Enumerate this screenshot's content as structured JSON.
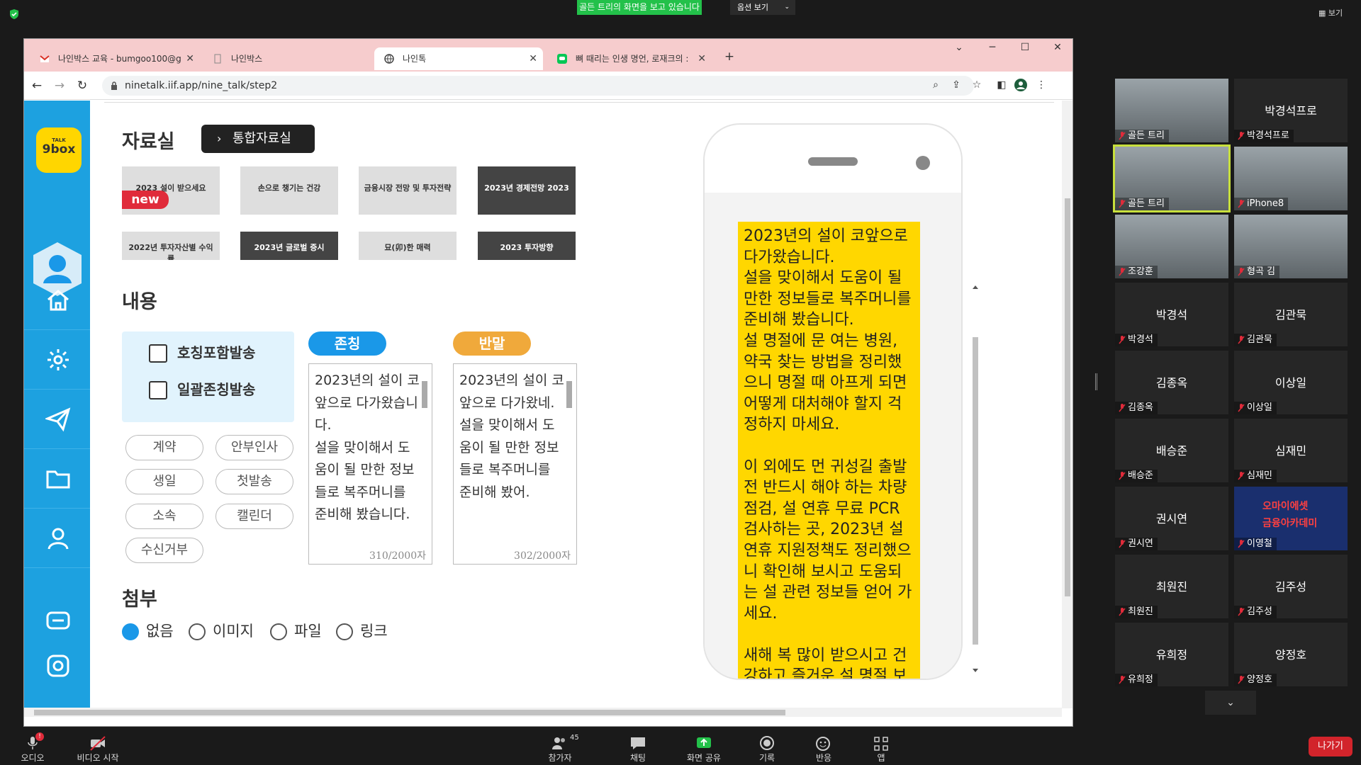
{
  "zoom": {
    "share_banner": "골든 트리의 화면을 보고 있습니다",
    "options_label": "옵션 보기",
    "view_label": "보기",
    "leave_label": "나가기",
    "toolbar": [
      {
        "label": "오디오",
        "icon": "mic-muted-icon"
      },
      {
        "label": "비디오 시작",
        "icon": "video-off-icon"
      },
      {
        "label": "참가자",
        "icon": "participants-icon",
        "count": "45"
      },
      {
        "label": "채팅",
        "icon": "chat-icon"
      },
      {
        "label": "화면 공유",
        "icon": "share-screen-icon"
      },
      {
        "label": "기록",
        "icon": "record-icon"
      },
      {
        "label": "반응",
        "icon": "reaction-icon"
      },
      {
        "label": "앱",
        "icon": "apps-icon"
      }
    ],
    "mic_badge": "!",
    "participants": [
      {
        "name": "골든 트리",
        "label": "골든 트리",
        "video": true
      },
      {
        "name": "박경석프로",
        "label": "박경석프로",
        "video": false
      },
      {
        "name": "골든 트리",
        "label": "골든 트리",
        "video": true,
        "speaker": true
      },
      {
        "name": "iPhone8",
        "label": "iPhone8",
        "video": true
      },
      {
        "name": "조강훈",
        "label": "조강훈",
        "video": true
      },
      {
        "name": "형곡 김",
        "label": "형곡 김",
        "video": true
      },
      {
        "name": "박경석",
        "label": "박경석",
        "video": false
      },
      {
        "name": "김관묵",
        "label": "김관묵",
        "video": false
      },
      {
        "name": "김종옥",
        "label": "김종옥",
        "video": false
      },
      {
        "name": "이상일",
        "label": "이상일",
        "video": false
      },
      {
        "name": "배승준",
        "label": "배승준",
        "video": false
      },
      {
        "name": "심재민",
        "label": "심재민",
        "video": false
      },
      {
        "name": "권시연",
        "label": "권시연",
        "video": false
      },
      {
        "name": "이영철",
        "label": "이영철",
        "video": true,
        "overlay": "오마이에셋\n금융아카데미"
      },
      {
        "name": "최원진",
        "label": "최원진",
        "video": false
      },
      {
        "name": "김주성",
        "label": "김주성",
        "video": false
      },
      {
        "name": "유희정",
        "label": "유희정",
        "video": false
      },
      {
        "name": "양정호",
        "label": "양정호",
        "video": false
      }
    ]
  },
  "browser": {
    "tabs": [
      {
        "title": "나인박스 교육 - bumgoo100@g",
        "icon": "gmail-icon"
      },
      {
        "title": "나인박스",
        "icon": "page-icon"
      },
      {
        "title": "나인톡",
        "icon": "globe-icon",
        "active": true
      },
      {
        "title": "뼈 때리는 인생 명언, 로재크의 :",
        "icon": "line-icon"
      }
    ],
    "new_tab": "+",
    "url": "ninetalk.iif.app/nine_talk/step2"
  },
  "page": {
    "logo_top": "TALK",
    "logo_main": "9box",
    "archive_title": "자료실",
    "archive_button": "통합자료실",
    "new_badge": "new",
    "thumbnails": [
      {
        "text": "2023 설이 받으세요"
      },
      {
        "text": "손으로 챙기는 건강"
      },
      {
        "text": "금융시장 전망 및 투자전략"
      },
      {
        "text": "2023년 경제전망 2023",
        "dark": true
      },
      {
        "text": "2022년 투자자산별 수익률"
      },
      {
        "text": "2023년 글로벌 증시",
        "dark": true
      },
      {
        "text": "묘(卯)한 매력"
      },
      {
        "text": "2023 투자방향",
        "dark": true
      }
    ],
    "content_title": "내용",
    "checkbox_honorific": "호칭포함발송",
    "checkbox_bulk": "일괄존칭발송",
    "pills": [
      "계약",
      "안부인사",
      "생일",
      "첫발송",
      "소속",
      "캘린더",
      "수신거부"
    ],
    "formal_label": "존칭",
    "casual_label": "반말",
    "formal_text": "2023년의 설이 코앞으로 다가왔습니다.\n설을 맞이해서 도움이 될 만한 정보들로 복주머니를 준비해 봤습니다.",
    "casual_text": "2023년의 설이 코앞으로 다가왔네.\n설을 맞이해서 도움이 될 만한 정보들로 복주머니를 준비해 봤어.",
    "formal_count": "310/2000자",
    "casual_count": "302/2000자",
    "attach_title": "첨부",
    "attach_options": [
      {
        "label": "없음",
        "selected": true
      },
      {
        "label": "이미지",
        "selected": false
      },
      {
        "label": "파일",
        "selected": false
      },
      {
        "label": "링크",
        "selected": false
      }
    ],
    "preview_text": "2023년의 설이 코앞으로 다가왔습니다.\n설을 맞이해서 도움이 될 만한 정보들로 복주머니를 준비해 봤습니다.\n설 명절에 문 여는 병원, 약국 찾는 방법을 정리했으니 명절 때 아프게 되면 어떻게 대처해야 할지 걱정하지 마세요.\n\n이 외에도 먼 귀성길 출발 전 반드시 해야 하는 차량 점검, 설 연휴 무료 PCR 검사하는 곳, 2023년 설 연휴 지원정책도 정리했으니 확인해 보시고 도움되는 설 관련 정보들 얻어 가세요.\n\n새해 복 많이 받으시고 건강하고 즐거운 설 명절 보"
  },
  "colors": {
    "sidebar": "#1da1e0",
    "bubble": "#ffd700",
    "formal": "#1a98e8",
    "casual": "#f0a93b",
    "banner": "#23c14a",
    "leave": "#d2242b"
  }
}
